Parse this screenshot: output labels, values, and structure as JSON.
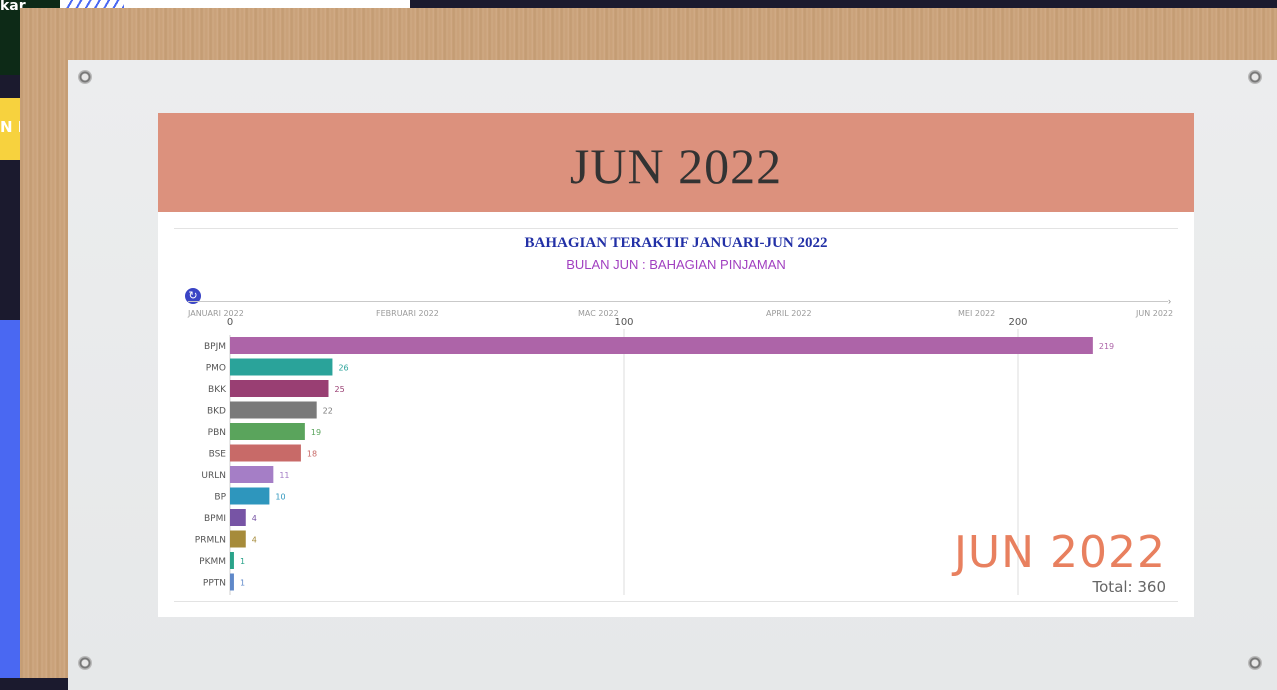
{
  "background": {
    "top_left_text": "kar",
    "yellow_text": "N M"
  },
  "banner": {
    "title": "JUN 2022"
  },
  "chart_data": {
    "type": "bar",
    "orientation": "horizontal",
    "title": "BAHAGIAN TERAKTIF JANUARI-JUN 2022",
    "subtitle": "BULAN JUN : BAHAGIAN PINJAMAN",
    "timeline": [
      "JANUARI 2022",
      "FEBRUARI 2022",
      "MAC 2022",
      "APRIL 2022",
      "MEI 2022",
      "JUN 2022"
    ],
    "xlim": [
      0,
      240
    ],
    "xticks": [
      0,
      100,
      200
    ],
    "grid": true,
    "categories": [
      "BPJM",
      "PMO",
      "BKK",
      "BKD",
      "PBN",
      "BSE",
      "URLN",
      "BP",
      "BPMI",
      "PRMLN",
      "PKMM",
      "PPTN"
    ],
    "values": [
      219,
      26,
      25,
      22,
      19,
      18,
      11,
      10,
      4,
      4,
      1,
      1
    ],
    "colors": [
      "#ad64a8",
      "#2aa39a",
      "#993f73",
      "#7a7a7a",
      "#5aa45c",
      "#c86a68",
      "#a57ec6",
      "#2e96bd",
      "#7754a5",
      "#a68b3a",
      "#2aa38a",
      "#5f88c9"
    ],
    "period_label": "JUN 2022",
    "total_label": "Total: 360"
  }
}
